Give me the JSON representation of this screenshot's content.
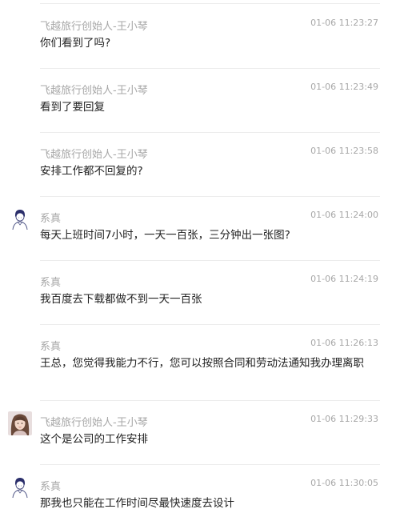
{
  "messages": [
    {
      "sender": "飞越旅行创始人-王小琴",
      "time": "01-06 11:23:27",
      "text": "你们看到了吗?",
      "avatar": ""
    },
    {
      "sender": "飞越旅行创始人-王小琴",
      "time": "01-06 11:23:49",
      "text": "看到了要回复",
      "avatar": ""
    },
    {
      "sender": "飞越旅行创始人-王小琴",
      "time": "01-06 11:23:58",
      "text": "安排工作都不回复的?",
      "avatar": ""
    },
    {
      "sender": "系真",
      "time": "01-06 11:24:00",
      "text": "每天上班时间7小时，一天一百张，三分钟出一张图?",
      "avatar": "cartoon-person-avatar"
    },
    {
      "sender": "系真",
      "time": "01-06 11:24:19",
      "text": "我百度去下载都做不到一天一百张",
      "avatar": ""
    },
    {
      "sender": "系真",
      "time": "01-06 11:26:13",
      "text": "王总，您觉得我能力不行，您可以按照合同和劳动法通知我办理离职",
      "avatar": ""
    },
    {
      "sender": "飞越旅行创始人-王小琴",
      "time": "01-06 11:29:33",
      "text": "这个是公司的工作安排",
      "avatar": "woman-photo-avatar"
    },
    {
      "sender": "系真",
      "time": "01-06 11:30:05",
      "text": "那我也只能在工作时间尽最快速度去设计",
      "avatar": "cartoon-person-avatar"
    }
  ]
}
